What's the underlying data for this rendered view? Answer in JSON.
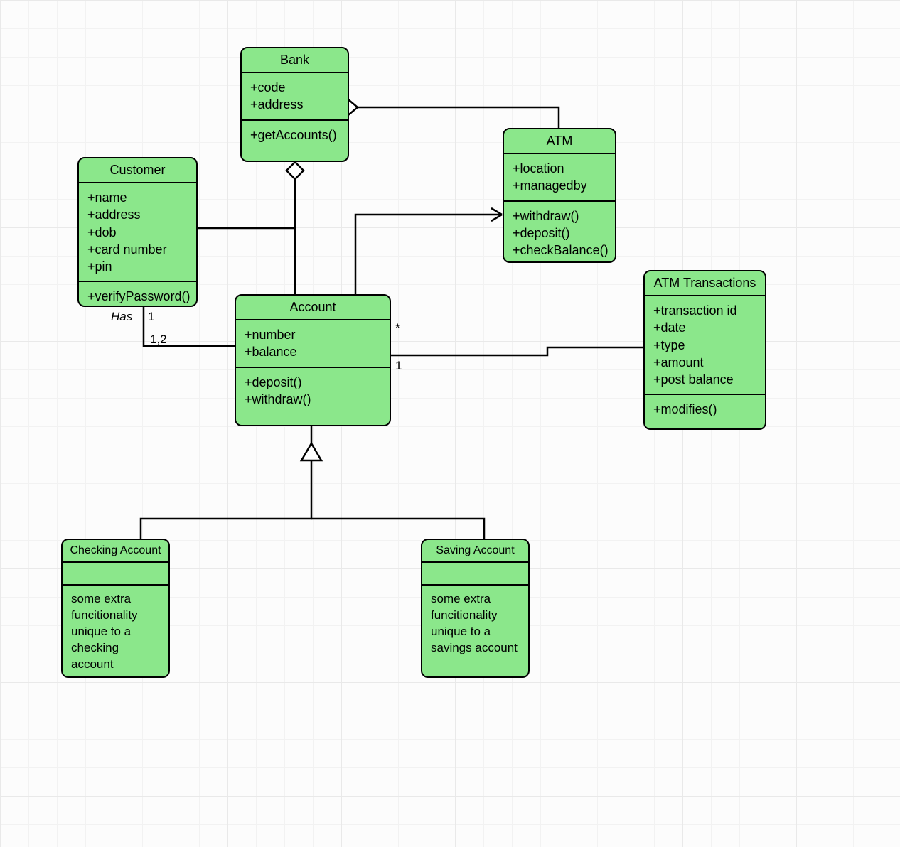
{
  "classes": {
    "bank": {
      "title": "Bank",
      "attrs": [
        "+code",
        "+address"
      ],
      "ops": [
        "+getAccounts()"
      ]
    },
    "customer": {
      "title": "Customer",
      "attrs": [
        "+name",
        "+address",
        "+dob",
        "+card number",
        "+pin"
      ],
      "ops": [
        "+verifyPassword()"
      ]
    },
    "atm": {
      "title": "ATM",
      "attrs": [
        "+location",
        "+managedby"
      ],
      "ops": [
        "+withdraw()",
        "+deposit()",
        "+checkBalance()"
      ]
    },
    "account": {
      "title": "Account",
      "attrs": [
        "+number",
        "+balance"
      ],
      "ops": [
        "+deposit()",
        "+withdraw()"
      ]
    },
    "atmTx": {
      "title": "ATM Transactions",
      "attrs": [
        "+transaction id",
        "+date",
        "+type",
        "+amount",
        "+post balance"
      ],
      "ops": [
        "+modifies()"
      ]
    },
    "checking": {
      "title": "Checking Account",
      "attrs": [],
      "ops": [
        "some extra funcitionality unique to a checking account"
      ]
    },
    "saving": {
      "title": "Saving Account",
      "attrs": [],
      "ops": [
        "some extra funcitionality unique to a savings account"
      ]
    }
  },
  "labels": {
    "has": "Has",
    "one": "1",
    "one2": "1",
    "oneTwo": "1,2",
    "star": "*"
  }
}
